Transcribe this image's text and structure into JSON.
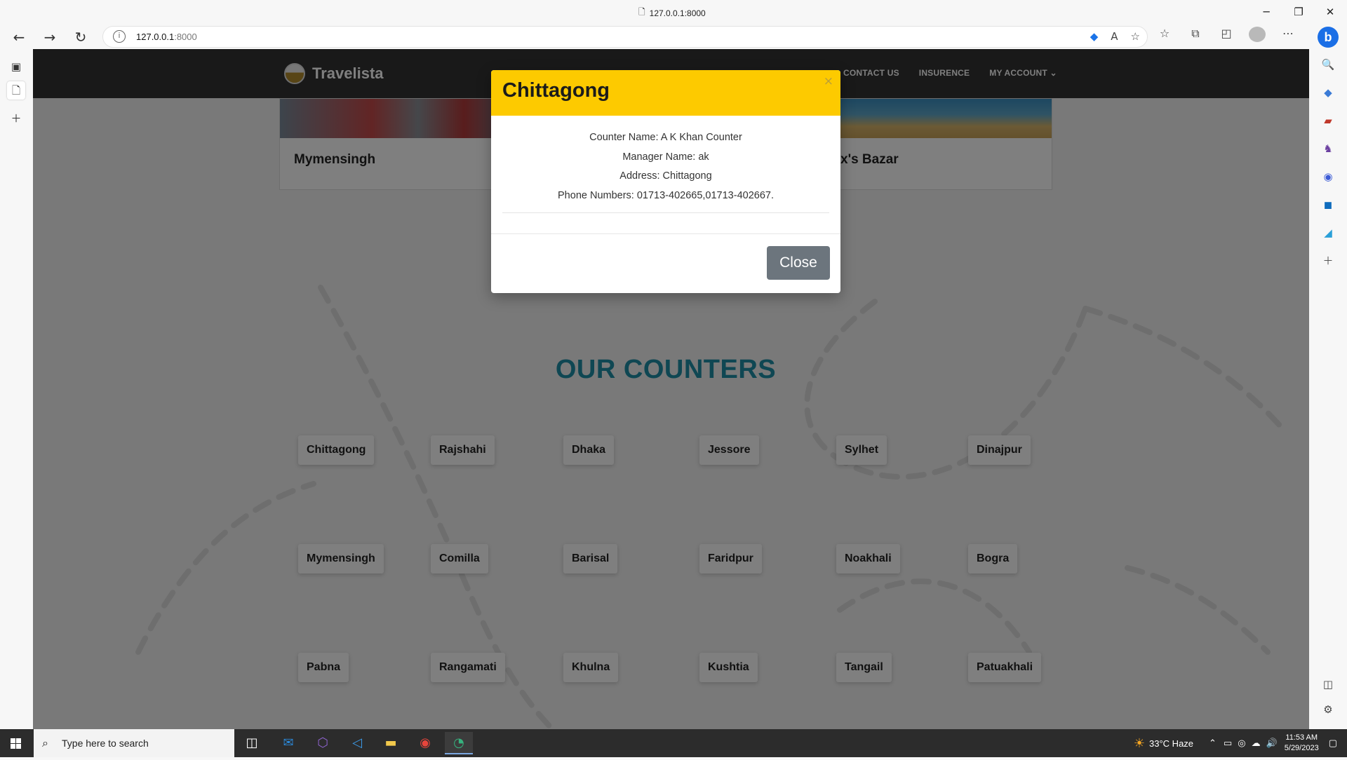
{
  "browser": {
    "tab_title": "127.0.0.1:8000",
    "url_host": "127.0.0.1",
    "url_port": ":8000"
  },
  "site": {
    "logo_text": "Travelista",
    "nav": [
      "CONTACT US",
      "INSURENCE",
      "MY ACCOUNT"
    ]
  },
  "destinations": [
    {
      "title": "Mymensingh"
    },
    {
      "title": "x's Bazar"
    }
  ],
  "counters": {
    "title": "OUR COUNTERS",
    "items": [
      "Chittagong",
      "Rajshahi",
      "Dhaka",
      "Jessore",
      "Sylhet",
      "Dinajpur",
      "Mymensingh",
      "Comilla",
      "Barisal",
      "Faridpur",
      "Noakhali",
      "Bogra",
      "Pabna",
      "Rangamati",
      "Khulna",
      "Kushtia",
      "Tangail",
      "Patuakhali"
    ]
  },
  "modal": {
    "title": "Chittagong",
    "close_x": "×",
    "lines": [
      "Counter Name: A K Khan Counter",
      "Manager Name: ak",
      "Address: Chittagong",
      "Phone Numbers: 01713-402665,01713-402667."
    ],
    "close_label": "Close"
  },
  "taskbar": {
    "search_placeholder": "Type here to search",
    "weather": "33°C  Haze",
    "time": "11:53 AM",
    "date": "5/29/2023"
  },
  "colors": {
    "modal_header": "#fdca00",
    "counters_title": "#1f8ea6",
    "close_button": "#6c757d"
  }
}
